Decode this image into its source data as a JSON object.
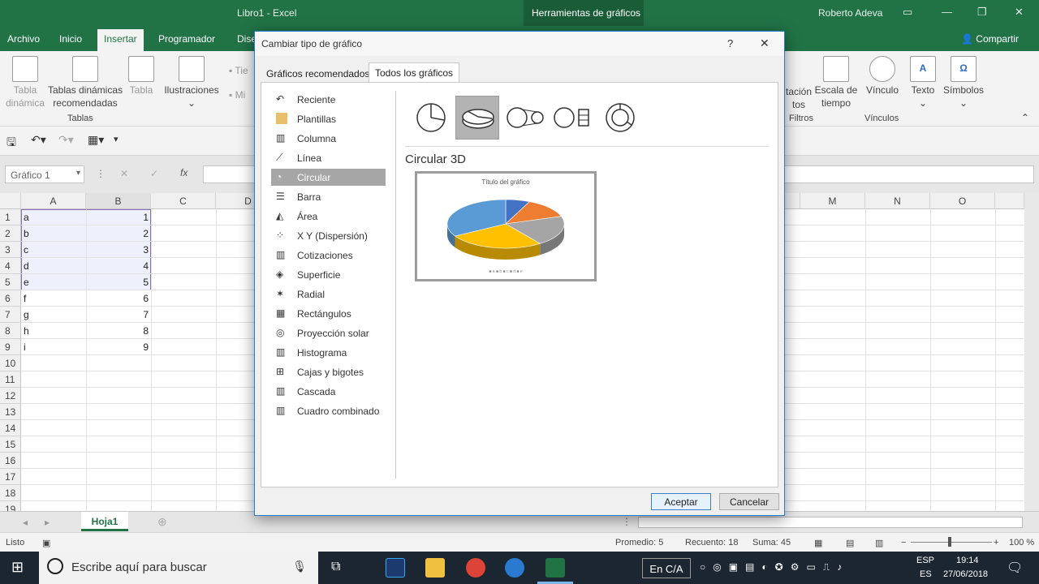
{
  "window": {
    "title": "Libro1 - Excel",
    "context_tab": "Herramientas de gráficos",
    "user": "Roberto Adeva"
  },
  "ribbon_tabs": [
    "Archivo",
    "Inicio",
    "Insertar",
    "Programador",
    "Dise"
  ],
  "share_label": "Compartir",
  "ribbon": {
    "tabla_dinamica": "Tabla dinámica",
    "tablas_recomendadas": "Tablas dinámicas recomendadas",
    "tabla": "Tabla",
    "tablas_group": "Tablas",
    "ilustraciones": "Ilustraciones",
    "tie": "Tie",
    "mi": "Mi",
    "segmentacion": "tación tos",
    "escala": "Escala de tiempo",
    "filtros_group": "Filtros",
    "vinculo": "Vínculo",
    "vinculos_group": "Vínculos",
    "texto": "Texto",
    "simbolos": "Símbolos"
  },
  "namebox": "Gráfico 1",
  "columns": [
    "A",
    "B",
    "C",
    "D",
    "M",
    "N",
    "O"
  ],
  "rows": [
    "1",
    "2",
    "3",
    "4",
    "5",
    "6",
    "7",
    "8",
    "9",
    "10",
    "11",
    "12",
    "13",
    "14",
    "15",
    "16",
    "17",
    "18",
    "19"
  ],
  "cells_a": [
    "a",
    "b",
    "c",
    "d",
    "e",
    "f",
    "g",
    "h",
    "i"
  ],
  "cells_b": [
    "1",
    "2",
    "3",
    "4",
    "5",
    "6",
    "7",
    "8",
    "9"
  ],
  "sheet_tab": "Hoja1",
  "status": {
    "ready": "Listo",
    "promedio": "Promedio: 5",
    "recuento": "Recuento: 18",
    "suma": "Suma: 45",
    "zoom": "100 %"
  },
  "taskbar": {
    "search_placeholder": "Escribe aquí para buscar",
    "en_ca": "En C/A",
    "lang1": "ESP",
    "lang2": "ES",
    "time": "19:14",
    "date": "27/06/2018"
  },
  "dialog": {
    "title": "Cambiar tipo de gráfico",
    "help": "?",
    "close": "✕",
    "tab_recommended": "Gráficos recomendados",
    "tab_all": "Todos los gráficos",
    "categories": [
      "Reciente",
      "Plantillas",
      "Columna",
      "Línea",
      "Circular",
      "Barra",
      "Área",
      "X Y (Dispersión)",
      "Cotizaciones",
      "Superficie",
      "Radial",
      "Rectángulos",
      "Proyección solar",
      "Histograma",
      "Cajas y bigotes",
      "Cascada",
      "Cuadro combinado"
    ],
    "selected_category": "Circular",
    "subtype_title": "Circular 3D",
    "preview_title": "Título del gráfico",
    "preview_legend": "■ a ■ b ■ c ■ d ■ e",
    "ok": "Aceptar",
    "cancel": "Cancelar"
  },
  "chart_data": {
    "type": "pie",
    "title": "Título del gráfico",
    "categories": [
      "a",
      "b",
      "c",
      "d",
      "e"
    ],
    "values": [
      1,
      2,
      3,
      4,
      5
    ],
    "colors": [
      "#4472c4",
      "#ed7d31",
      "#a5a5a5",
      "#ffc000",
      "#5b9bd5"
    ]
  }
}
